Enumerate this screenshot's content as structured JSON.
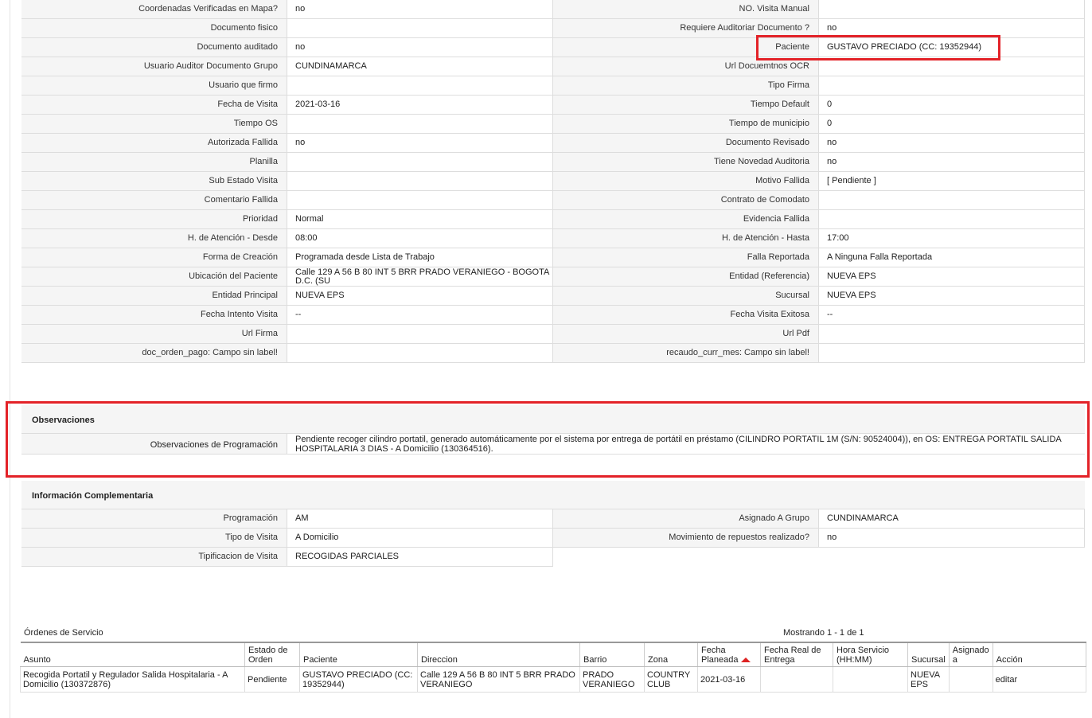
{
  "fields": [
    {
      "l1": "Coordenadas Verificadas en Mapa?",
      "v1": "no",
      "l2": "NO. Visita Manual",
      "v2": ""
    },
    {
      "l1": "Documento fisico",
      "v1": "",
      "l2": "Requiere Auditoriar Documento ?",
      "v2": "no"
    },
    {
      "l1": "Documento auditado",
      "v1": "no",
      "l2": "Paciente",
      "v2": "GUSTAVO PRECIADO (CC: 19352944)"
    },
    {
      "l1": "Usuario Auditor Documento Grupo",
      "v1": "CUNDINAMARCA",
      "l2": "Url Docuemtnos OCR",
      "v2": ""
    },
    {
      "l1": "Usuario que firmo",
      "v1": "",
      "l2": "Tipo Firma",
      "v2": ""
    },
    {
      "l1": "Fecha de Visita",
      "v1": "2021-03-16",
      "l2": "Tiempo Default",
      "v2": "0"
    },
    {
      "l1": "Tiempo OS",
      "v1": "",
      "l2": "Tiempo de municipio",
      "v2": "0"
    },
    {
      "l1": "Autorizada Fallida",
      "v1": "no",
      "l2": "Documento Revisado",
      "v2": "no"
    },
    {
      "l1": "Planilla",
      "v1": "",
      "l2": "Tiene Novedad Auditoria",
      "v2": "no"
    },
    {
      "l1": "Sub Estado Visita",
      "v1": "",
      "l2": "Motivo Fallida",
      "v2": "[ Pendiente ]"
    },
    {
      "l1": "Comentario Fallida",
      "v1": "",
      "l2": "Contrato de Comodato",
      "v2": ""
    },
    {
      "l1": "Prioridad",
      "v1": "Normal",
      "l2": "Evidencia Fallida",
      "v2": ""
    },
    {
      "l1": "H. de Atención - Desde",
      "v1": "08:00",
      "l2": "H. de Atención - Hasta",
      "v2": "17:00"
    },
    {
      "l1": "Forma de Creación",
      "v1": "Programada desde Lista de Trabajo",
      "l2": "Falla Reportada",
      "v2": "A Ninguna Falla Reportada"
    },
    {
      "l1": "Ubicación del Paciente",
      "v1": "Calle 129 A 56 B 80 INT 5 BRR PRADO VERANIEGO - BOGOTA D.C. (SU",
      "l2": "Entidad (Referencia)",
      "v2": "NUEVA EPS"
    },
    {
      "l1": "Entidad Principal",
      "v1": "NUEVA EPS",
      "l2": "Sucursal",
      "v2": "NUEVA EPS"
    },
    {
      "l1": "Fecha Intento Visita",
      "v1": "--",
      "l2": "Fecha Visita Exitosa",
      "v2": "--"
    },
    {
      "l1": "Url Firma",
      "v1": "",
      "l2": "Url Pdf",
      "v2": ""
    },
    {
      "l1": "doc_orden_pago: Campo sin label!",
      "v1": "",
      "l2": "recaudo_curr_mes: Campo sin label!",
      "v2": ""
    }
  ],
  "observaciones": {
    "title": "Observaciones",
    "label": "Observaciones de Programación",
    "value": "Pendiente recoger cilindro portatil, generado automáticamente por el sistema por entrega de portátil en préstamo (CILINDRO PORTATIL 1M (S/N: 90524004)), en OS: ENTREGA PORTATIL SALIDA HOSPITALARIA 3 DIAS - A Domicilio (130364516)."
  },
  "complementaria": {
    "title": "Información Complementaria",
    "rows": [
      {
        "l1": "Programación",
        "v1": "AM",
        "l2": "Asignado A Grupo",
        "v2": "CUNDINAMARCA"
      },
      {
        "l1": "Tipo de Visita",
        "v1": "A Domicilio",
        "l2": "Movimiento de repuestos realizado?",
        "v2": "no"
      },
      {
        "l1": "Tipificacion de Visita",
        "v1": "RECOGIDAS PARCIALES"
      }
    ]
  },
  "ordenes": {
    "title": "Órdenes de Servicio",
    "count": "Mostrando 1 - 1 de 1",
    "headers": [
      "Asunto",
      "Estado de Orden",
      "Paciente",
      "Direccion",
      "Barrio",
      "Zona",
      "Fecha Planeada",
      "Fecha Real de Entrega",
      "Hora Servicio (HH:MM)",
      "Sucursal",
      "Asignado a",
      "Acción"
    ],
    "row": {
      "asunto": "Recogida Portatil y Regulador Salida Hospitalaria - A Domicilio (130372876)",
      "estado": "Pendiente",
      "paciente": "GUSTAVO PRECIADO (CC: 19352944)",
      "direccion": "Calle 129 A 56 B 80 INT 5 BRR PRADO VERANIEGO",
      "barrio": "PRADO VERANIEGO",
      "zona": "COUNTRY CLUB",
      "fecha_planeada": "2021-03-16",
      "fecha_real": "",
      "hora": "",
      "sucursal": "NUEVA EPS",
      "asignado": "",
      "accion": "editar"
    }
  },
  "colors": {
    "highlight": "#e32228",
    "label_bg": "#f5f5f5",
    "border": "#dddddd"
  }
}
